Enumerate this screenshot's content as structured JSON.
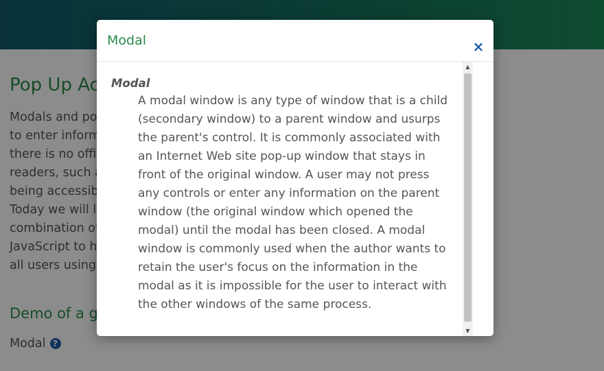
{
  "page": {
    "heading": "Pop Up Ac",
    "intro_lines": [
      "Modals and pop",
      "to enter inform",
      "there is no offi",
      "readers, such a",
      "being accessibl",
      "Today we will l",
      "combination of",
      "JavaScript to he",
      "all users using J"
    ],
    "demo_heading": "Demo of a glo",
    "demo_label": "Modal",
    "help_icon": "?"
  },
  "modal": {
    "title": "Modal",
    "close_symbol": "×",
    "term": "Modal",
    "description": "A modal window is any type of window that is a child (secondary window) to a parent window and usurps the parent's control. It is commonly associated with an Internet Web site pop-up window that stays in front of the original window. A user may not press any controls or enter any information on the parent window (the original window which opened the modal) until the modal has been closed. A modal window is commonly used when the author wants to retain the user's focus on the information in the modal as it is impossible for the user to interact with the other windows of the same process."
  },
  "scrollbar": {
    "up_arrow": "▲",
    "down_arrow": "▼"
  },
  "colors": {
    "accent_green": "#2a8a4a",
    "link_blue": "#1f5fa8",
    "header_gradient_start": "#0f5a6e",
    "header_gradient_end": "#1b8a56"
  }
}
